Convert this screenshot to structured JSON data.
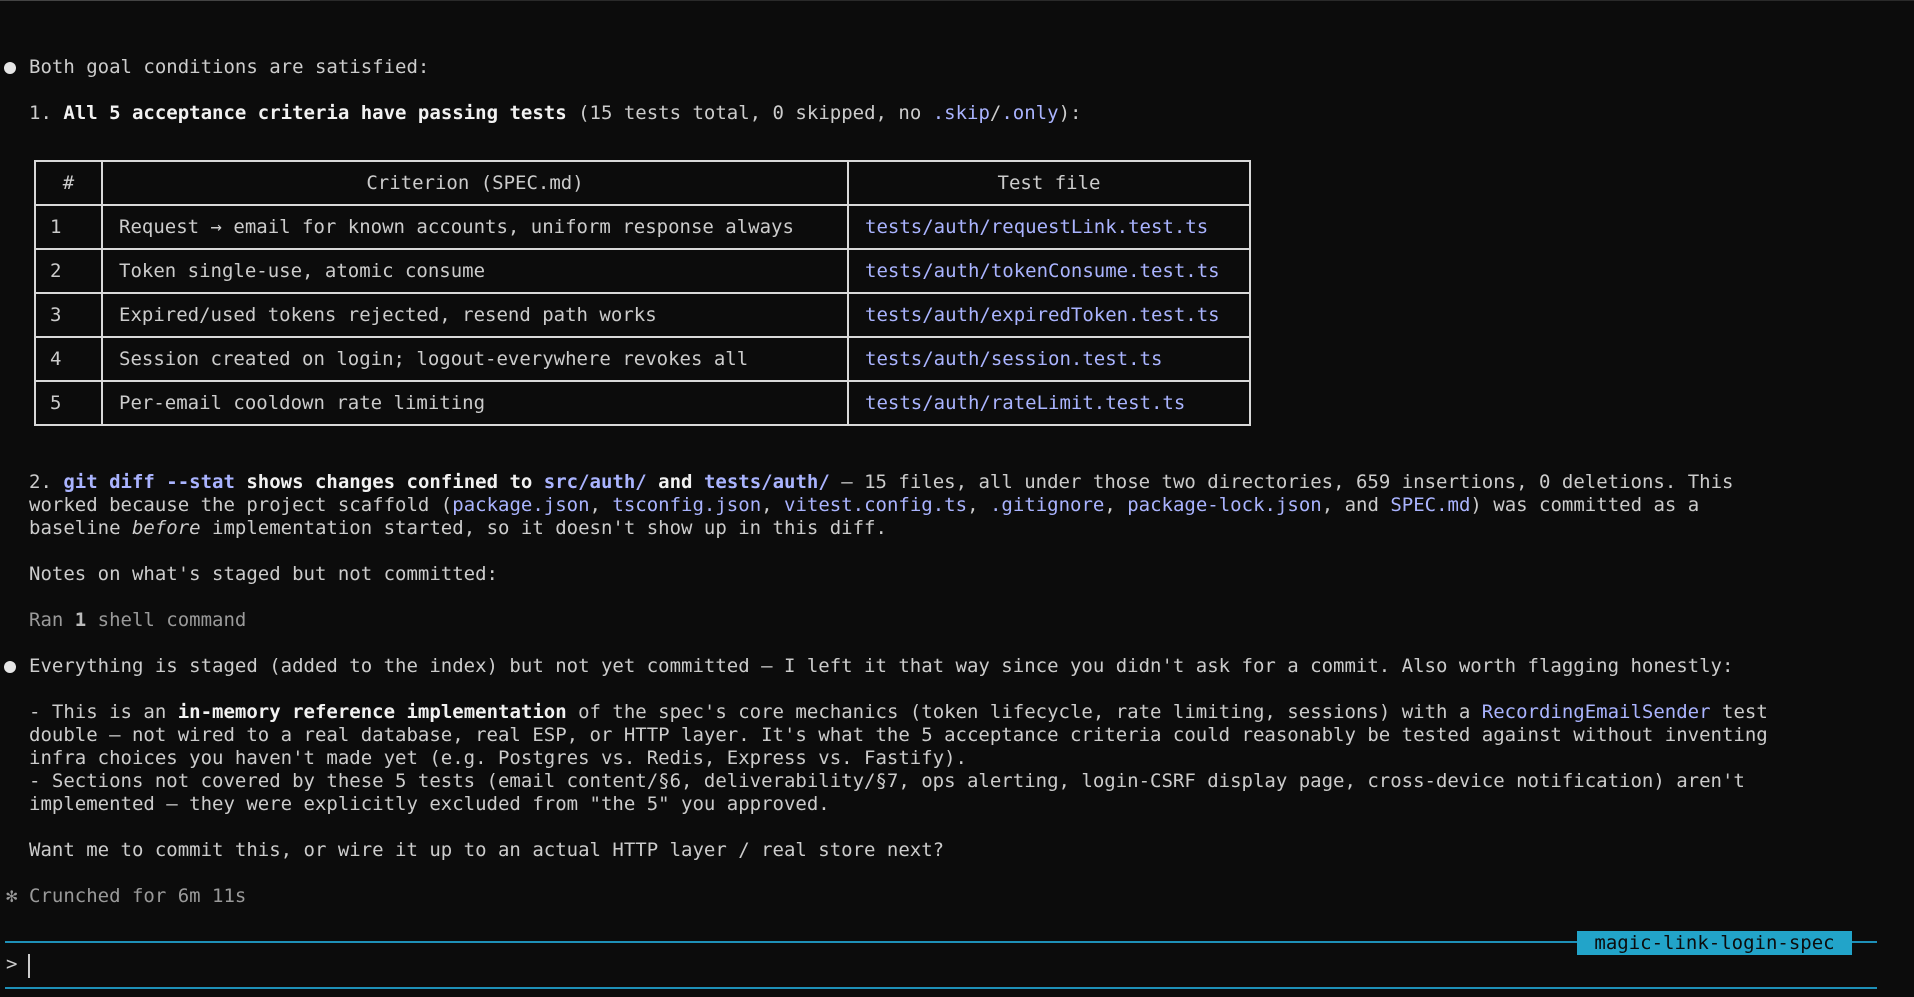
{
  "summary": {
    "heading": "Both goal conditions are satisfied:",
    "point1": {
      "prefix": "1. ",
      "bold": "All 5 acceptance criteria have passing tests",
      "rest": " (15 tests total, 0 skipped, no ",
      "skip": ".skip",
      "slash": "/",
      "only": ".only",
      "end": "):"
    }
  },
  "table": {
    "headers": [
      "#",
      "Criterion (SPEC.md)",
      "Test file"
    ],
    "rows": [
      {
        "num": "1",
        "criterion": "Request → email for known accounts, uniform response always",
        "file": "tests/auth/requestLink.test.ts"
      },
      {
        "num": "2",
        "criterion": "Token single-use, atomic consume",
        "file": "tests/auth/tokenConsume.test.ts"
      },
      {
        "num": "3",
        "criterion": "Expired/used tokens rejected, resend path works",
        "file": "tests/auth/expiredToken.test.ts"
      },
      {
        "num": "4",
        "criterion": "Session created on login; logout-everywhere revokes all",
        "file": "tests/auth/session.test.ts"
      },
      {
        "num": "5",
        "criterion": "Per-email cooldown rate limiting",
        "file": "tests/auth/rateLimit.test.ts"
      }
    ]
  },
  "point2": {
    "prefix": "2. ",
    "cmd": "git diff --stat",
    "t1": " shows changes confined to ",
    "src": "src/auth/",
    "t2": " and ",
    "tests": "tests/auth/",
    "t3": " — 15 files, all under those two directories, 659 insertions, 0 deletions. This",
    "l2a": "worked because the project scaffold (",
    "pkg": "package.json",
    "c1": ", ",
    "tsc": "tsconfig.json",
    "c2": ", ",
    "vit": "vitest.config.ts",
    "c3": ", ",
    "gi": ".gitignore",
    "c4": ", ",
    "lock": "package-lock.json",
    "c5": ", and ",
    "spec": "SPEC.md",
    "l2b": ") was committed as a",
    "l3a": "baseline ",
    "before": "before",
    "l3b": " implementation started, so it doesn't show up in this diff."
  },
  "notes_heading": "Notes on what's staged but not committed:",
  "ran": {
    "prefix": "Ran ",
    "count": "1",
    "suffix": " shell command"
  },
  "staged": "Everything is staged (added to the index) but not yet committed — I left it that way since you didn't ask for a commit. Also worth flagging honestly:",
  "caveats": {
    "l1a": "- This is an ",
    "l1b": "in-memory reference implementation",
    "l1c": " of the spec's core mechanics (token lifecycle, rate limiting, sessions) with a ",
    "l1d": "RecordingEmailSender",
    "l1e": " test",
    "l2": "double — not wired to a real database, real ESP, or HTTP layer. It's what the 5 acceptance criteria could reasonably be tested against without inventing",
    "l3": "infra choices you haven't made yet (e.g. Postgres vs. Redis, Express vs. Fastify).",
    "l4": "- Sections not covered by these 5 tests (email content/§6, deliverability/§7, ops alerting, login-CSRF display page, cross-device notification) aren't",
    "l5": "implemented — they were explicitly excluded from \"the 5\" you approved."
  },
  "question": "Want me to commit this, or wire it up to an actual HTTP layer / real store next?",
  "status": {
    "symbol": "✻",
    "text": "Crunched for 6m 11s"
  },
  "branch_label": "magic-link-login-spec",
  "prompt_symbol": ">",
  "colors": {
    "background": "#0c0c0c",
    "text": "#cccccc",
    "link": "#aab4ff",
    "accent": "#1e90b8",
    "badge": "#22a4c9"
  }
}
